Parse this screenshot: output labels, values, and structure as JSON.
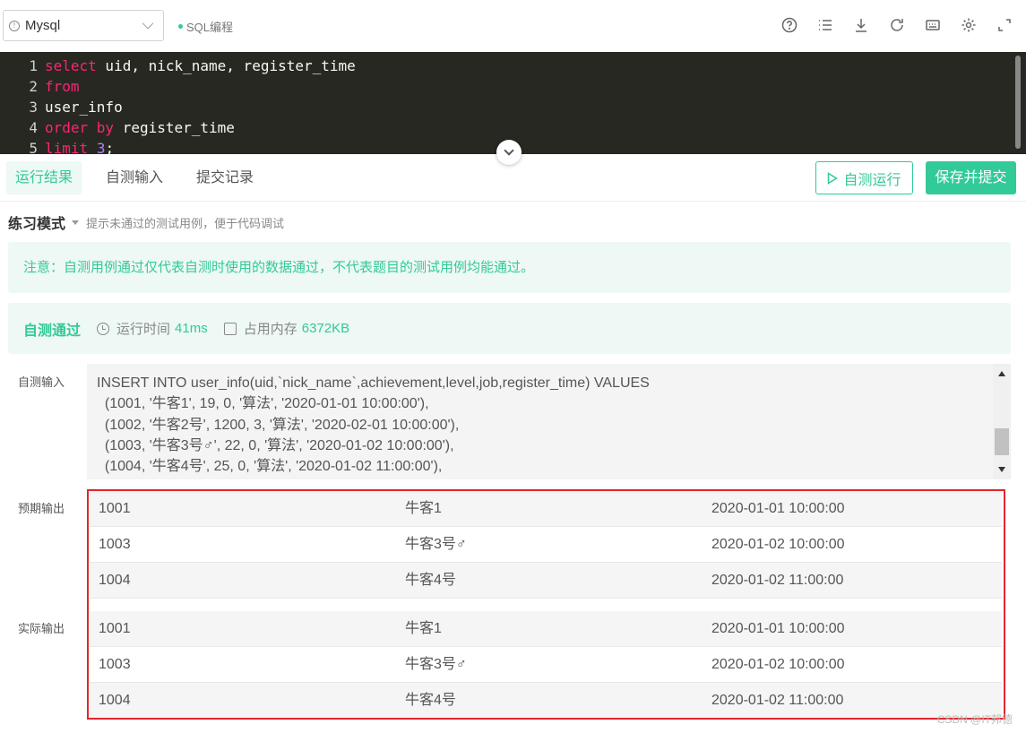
{
  "toolbar": {
    "language": "Mysql",
    "mode_tag": "SQL编程",
    "icons": [
      "help-icon",
      "list-icon",
      "download-icon",
      "refresh-icon",
      "keyboard-icon",
      "settings-icon",
      "fullscreen-icon"
    ]
  },
  "editor": {
    "lines": [
      {
        "n": "1",
        "parts": [
          {
            "t": "select",
            "c": "kw"
          },
          {
            "t": " uid, nick_name, register_time",
            "c": "tx"
          }
        ]
      },
      {
        "n": "2",
        "parts": [
          {
            "t": "from",
            "c": "kw"
          }
        ]
      },
      {
        "n": "3",
        "parts": [
          {
            "t": "user_info",
            "c": "tx"
          }
        ]
      },
      {
        "n": "4",
        "parts": [
          {
            "t": "order by",
            "c": "kw"
          },
          {
            "t": " register_time",
            "c": "tx"
          }
        ]
      },
      {
        "n": "5",
        "parts": [
          {
            "t": "limit",
            "c": "kw"
          },
          {
            "t": " ",
            "c": "tx"
          },
          {
            "t": "3",
            "c": "num"
          },
          {
            "t": ";",
            "c": "tx"
          }
        ]
      }
    ]
  },
  "tabs": {
    "run_result": "运行结果",
    "self_test_input": "自测输入",
    "submit_history": "提交记录",
    "run_button": "自测运行",
    "submit_button": "保存并提交"
  },
  "practice": {
    "mode": "练习模式",
    "hint": "提示未通过的测试用例，便于代码调试"
  },
  "notice": "注意：自测用例通过仅代表自测时使用的数据通过，不代表题目的测试用例均能通过。",
  "status": {
    "result": "自测通过",
    "runtime_label": "运行时间",
    "runtime_value": "41ms",
    "memory_label": "占用内存",
    "memory_value": "6372KB"
  },
  "labels": {
    "input": "自测输入",
    "expected": "预期输出",
    "actual": "实际输出"
  },
  "self_input_lines": [
    "INSERT INTO user_info(uid,`nick_name`,achievement,level,job,register_time) VALUES",
    "  (1001, '牛客1', 19, 0, '算法', '2020-01-01 10:00:00'),",
    "  (1002, '牛客2号', 1200, 3, '算法', '2020-02-01 10:00:00'),",
    "  (1003, '牛客3号♂', 22, 0, '算法', '2020-01-02 10:00:00'),",
    "  (1004, '牛客4号', 25, 0, '算法', '2020-01-02 11:00:00'),"
  ],
  "expected_rows": [
    [
      "1001",
      "牛客1",
      "2020-01-01 10:00:00"
    ],
    [
      "1003",
      "牛客3号♂",
      "2020-01-02 10:00:00"
    ],
    [
      "1004",
      "牛客4号",
      "2020-01-02 11:00:00"
    ]
  ],
  "actual_rows": [
    [
      "1001",
      "牛客1",
      "2020-01-01 10:00:00"
    ],
    [
      "1003",
      "牛客3号♂",
      "2020-01-02 10:00:00"
    ],
    [
      "1004",
      "牛客4号",
      "2020-01-02 11:00:00"
    ]
  ],
  "watermark": "CSDN @IT邦德",
  "colors": {
    "accent": "#32ca99",
    "editor_bg": "#272822",
    "keyword": "#f92672",
    "highlight_frame": "#e0252c"
  }
}
